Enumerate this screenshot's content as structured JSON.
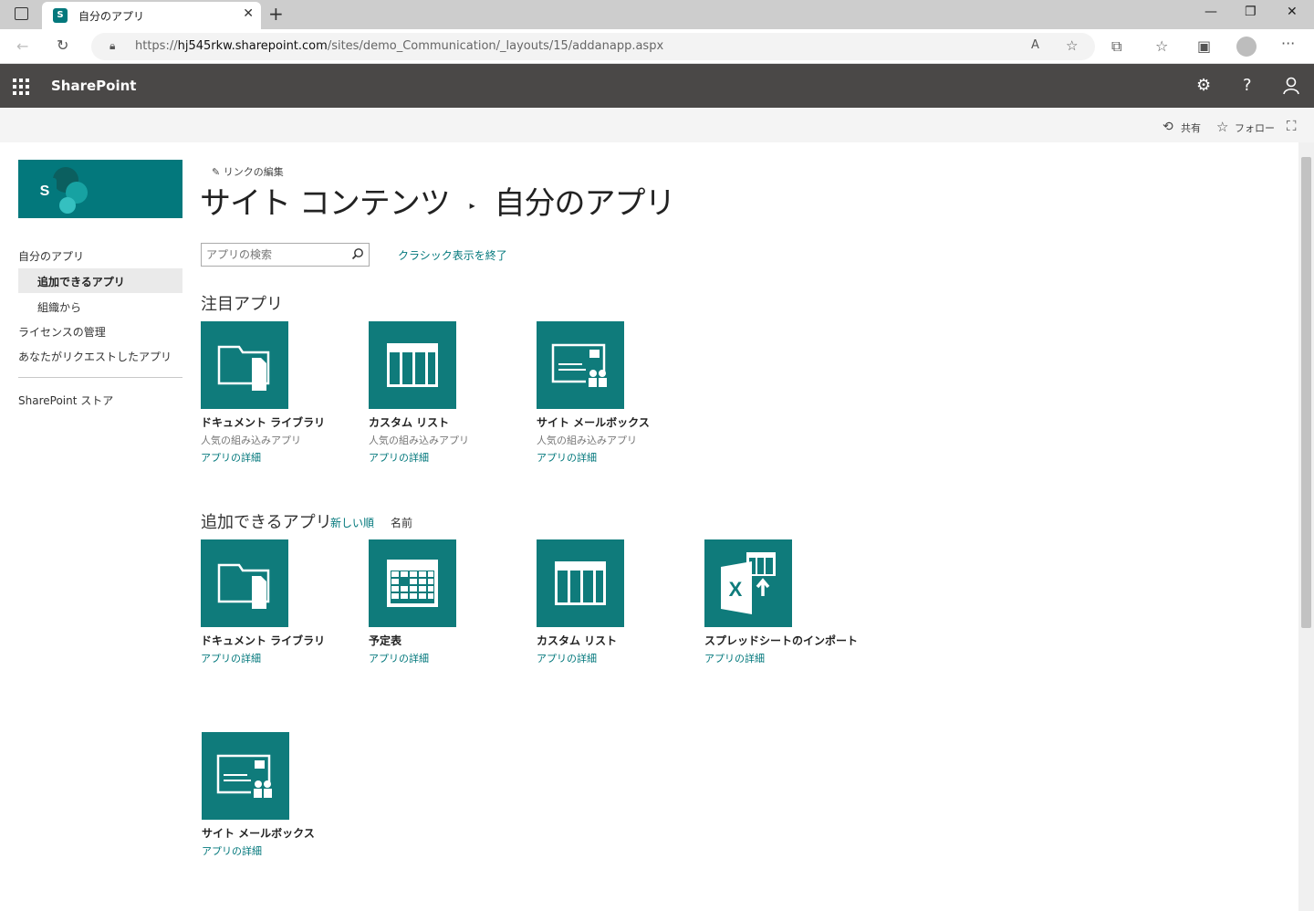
{
  "browser": {
    "tab_title": "自分のアプリ",
    "url_prefix": "https://",
    "url_host": "hj545rkw.sharepoint.com",
    "url_path": "/sites/demo_Communication/_layouts/15/addanapp.aspx"
  },
  "suite": {
    "brand": "SharePoint"
  },
  "ribbon": {
    "share": "共有",
    "follow": "フォロー"
  },
  "leftnav": {
    "items": [
      {
        "label": "自分のアプリ"
      },
      {
        "label": "追加できるアプリ"
      },
      {
        "label": "組織から"
      },
      {
        "label": "ライセンスの管理"
      },
      {
        "label": "あなたがリクエストしたアプリ"
      },
      {
        "label": "SharePoint ストア"
      }
    ]
  },
  "header": {
    "edit_links": "リンクの編集",
    "breadcrumb_parent": "サイト コンテンツ",
    "breadcrumb_current": "自分のアプリ",
    "search_placeholder": "アプリの検索",
    "classic_exit": "クラシック表示を終了"
  },
  "featured": {
    "title": "注目アプリ",
    "apps": [
      {
        "name": "ドキュメント ライブラリ",
        "sub": "人気の組み込みアプリ",
        "detail": "アプリの詳細",
        "icon": "document-library-icon"
      },
      {
        "name": "カスタム リスト",
        "sub": "人気の組み込みアプリ",
        "detail": "アプリの詳細",
        "icon": "custom-list-icon"
      },
      {
        "name": "サイト メールボックス",
        "sub": "人気の組み込みアプリ",
        "detail": "アプリの詳細",
        "icon": "site-mailbox-icon"
      }
    ]
  },
  "available": {
    "title": "追加できるアプリ",
    "sort_newest": "新しい順",
    "sort_name": "名前",
    "apps": [
      {
        "name": "ドキュメント ライブラリ",
        "detail": "アプリの詳細",
        "icon": "document-library-icon"
      },
      {
        "name": "予定表",
        "detail": "アプリの詳細",
        "icon": "calendar-icon"
      },
      {
        "name": "カスタム リスト",
        "detail": "アプリの詳細",
        "icon": "custom-list-icon"
      },
      {
        "name": "スプレッドシートのインポート",
        "detail": "アプリの詳細",
        "icon": "import-spreadsheet-icon"
      },
      {
        "name": "サイト メールボックス",
        "detail": "アプリの詳細",
        "icon": "site-mailbox-icon"
      }
    ]
  },
  "colors": {
    "accent": "#03787c",
    "tile": "#0f7b7b",
    "suitebar": "#4a4847"
  }
}
